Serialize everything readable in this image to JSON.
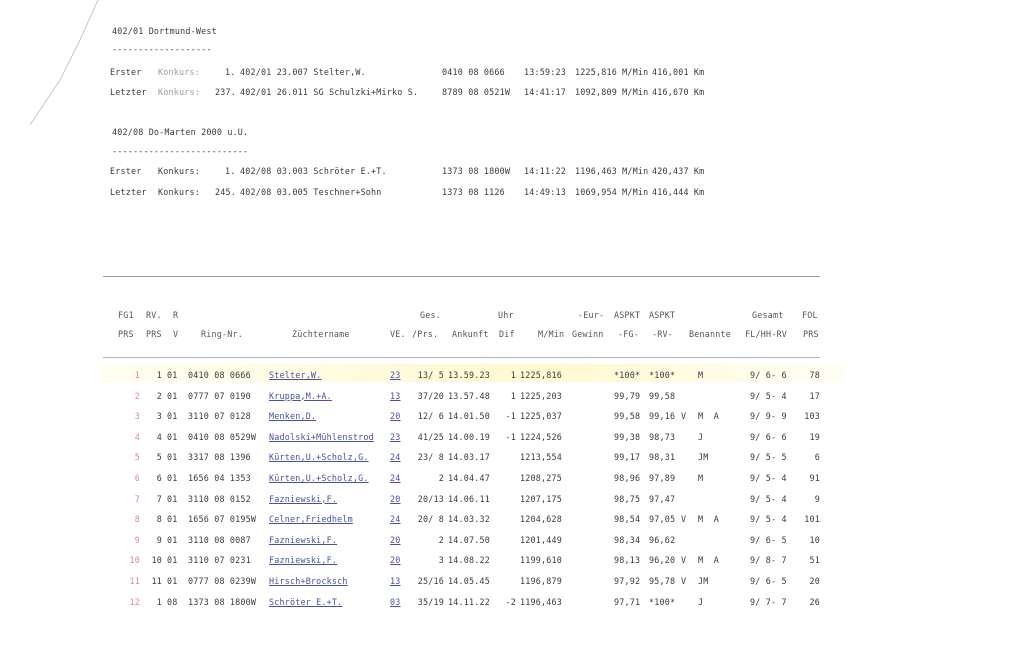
{
  "club1": {
    "title": "402/01 Dortmund-West",
    "underline": "-------------------",
    "first": {
      "label": "Erster",
      "label2": "Konkurs:",
      "rank": "1.",
      "line": "402/01 23.007 Stelter,W.",
      "ring": "0410 08 0666",
      "time": "13:59:23",
      "speed": "1225,816 M/Min",
      "km": "416,001 Km"
    },
    "last": {
      "label": "Letzter",
      "label2": "Konkurs:",
      "rank": "237.",
      "line": "402/01 26.011 SG Schulzki+Mirko S.",
      "ring": "8789 08 0521W",
      "time": "14:41:17",
      "speed": "1092,809 M/Min",
      "km": "416,670 Km"
    }
  },
  "club2": {
    "title": "402/08 Do-Marten 2000 u.U.",
    "underline": "--------------------------",
    "first": {
      "label": "Erster",
      "label2": "Konkurs:",
      "rank": "1.",
      "line": "402/08 03.003 Schröter E.+T.",
      "ring": "1373 08 1800W",
      "time": "14:11:22",
      "speed": "1196,463 M/Min",
      "km": "420,437 Km"
    },
    "last": {
      "label": "Letzter",
      "label2": "Konkurs:",
      "rank": "245.",
      "line": "402/08 03.005 Teschner+Sohn",
      "ring": "1373 08 1126",
      "time": "14:49:13",
      "speed": "1069,954 M/Min",
      "km": "416,444 Km"
    }
  },
  "header": {
    "r1": {
      "fg1": "FG1",
      "rv": "RV.",
      "r": "R",
      "ges": "Ges.",
      "uhr": "Uhr",
      "eur": "-Eur-",
      "aspkt1": "ASPKT",
      "aspkt2": "ASPKT",
      "gesamt": "Gesamt",
      "fol": "FOL"
    },
    "r2": {
      "prs1": "PRS",
      "prs2": "PRS",
      "v": "V",
      "ring": "Ring-Nr.",
      "zname": "Züchtername",
      "ve": "VE.",
      "prs": "/Prs.",
      "ankunft": "Ankunft",
      "dif": "Dif",
      "mmin": "M/Min",
      "gewinn": "Gewinn",
      "fg": "-FG-",
      "rvh": "-RV-",
      "benannte": "Benannte",
      "flhh": "FL/HH-RV",
      "prs3": "PRS"
    }
  },
  "rows": [
    {
      "n": "1",
      "rvprs": "1",
      "r": "01",
      "ring": "0410 08 0666",
      "name": "Stelter,W.",
      "ve": "23",
      "prs": "13/ 5",
      "ank": "13.59.23",
      "dif": "1",
      "mmin": "1225,816",
      "fg": "*100*",
      "rv": "*100*",
      "v": "",
      "ben": "M",
      "gesamt": "9/ 6- 6",
      "fol": "78"
    },
    {
      "n": "2",
      "rvprs": "2",
      "r": "01",
      "ring": "0777 07 0190",
      "name": "Kruppa,M.+A.",
      "ve": "13",
      "prs": "37/20",
      "ank": "13.57.48",
      "dif": "1",
      "mmin": "1225,203",
      "fg": "99,79",
      "rv": "99,58",
      "v": "",
      "ben": "",
      "gesamt": "9/ 5- 4",
      "fol": "17"
    },
    {
      "n": "3",
      "rvprs": "3",
      "r": "01",
      "ring": "3110 07 0128",
      "name": "Menken,D.",
      "ve": "20",
      "prs": "12/ 6",
      "ank": "14.01.50",
      "dif": "-1",
      "mmin": "1225,037",
      "fg": "99,58",
      "rv": "99,16",
      "v": "V",
      "ben": "M  A",
      "gesamt": "9/ 9- 9",
      "fol": "103"
    },
    {
      "n": "4",
      "rvprs": "4",
      "r": "01",
      "ring": "0410 08 0529W",
      "name": "Nadolski+Mühlenstrod",
      "ve": "23",
      "prs": "41/25",
      "ank": "14.00.19",
      "dif": "-1",
      "mmin": "1224,526",
      "fg": "99,38",
      "rv": "98,73",
      "v": "",
      "ben": "J",
      "gesamt": "9/ 6- 6",
      "fol": "19"
    },
    {
      "n": "5",
      "rvprs": "5",
      "r": "01",
      "ring": "3317 08 1396",
      "name": "Kürten,U.+Scholz,G.",
      "ve": "24",
      "prs": "23/ 8",
      "ank": "14.03.17",
      "dif": "",
      "mmin": "1213,554",
      "fg": "99,17",
      "rv": "98,31",
      "v": "",
      "ben": "JM",
      "gesamt": "9/ 5- 5",
      "fol": "6"
    },
    {
      "n": "6",
      "rvprs": "6",
      "r": "01",
      "ring": "1656 04 1353",
      "name": "Kürten,U.+Scholz,G.",
      "ve": "24",
      "prs": "2",
      "ank": "14.04.47",
      "dif": "",
      "mmin": "1208,275",
      "fg": "98,96",
      "rv": "97,89",
      "v": "",
      "ben": "M",
      "gesamt": "9/ 5- 4",
      "fol": "91"
    },
    {
      "n": "7",
      "rvprs": "7",
      "r": "01",
      "ring": "3110 08 0152",
      "name": "Fazniewski,F.",
      "ve": "20",
      "prs": "20/13",
      "ank": "14.06.11",
      "dif": "",
      "mmin": "1207,175",
      "fg": "98,75",
      "rv": "97,47",
      "v": "",
      "ben": "",
      "gesamt": "9/ 5- 4",
      "fol": "9"
    },
    {
      "n": "8",
      "rvprs": "8",
      "r": "01",
      "ring": "1656 07 0195W",
      "name": "Celner,Friedhelm",
      "ve": "24",
      "prs": "20/ 8",
      "ank": "14.03.32",
      "dif": "",
      "mmin": "1204,628",
      "fg": "98,54",
      "rv": "97,05",
      "v": "V",
      "ben": "M  A",
      "gesamt": "9/ 5- 4",
      "fol": "101"
    },
    {
      "n": "9",
      "rvprs": "9",
      "r": "01",
      "ring": "3110 08 0087",
      "name": "Fazniewski,F.",
      "ve": "20",
      "prs": "2",
      "ank": "14.07.50",
      "dif": "",
      "mmin": "1201,449",
      "fg": "98,34",
      "rv": "96,62",
      "v": "",
      "ben": "",
      "gesamt": "9/ 6- 5",
      "fol": "10"
    },
    {
      "n": "10",
      "rvprs": "10",
      "r": "01",
      "ring": "3110 07 0231",
      "name": "Fazniewski,F.",
      "ve": "20",
      "prs": "3",
      "ank": "14.08.22",
      "dif": "",
      "mmin": "1199,610",
      "fg": "98,13",
      "rv": "96,20",
      "v": "V",
      "ben": "M  A",
      "gesamt": "9/ 8- 7",
      "fol": "51"
    },
    {
      "n": "11",
      "rvprs": "11",
      "r": "01",
      "ring": "0777 08 0239W",
      "name": "Hirsch+Brocksch",
      "ve": "13",
      "prs": "25/16",
      "ank": "14.05.45",
      "dif": "",
      "mmin": "1196,879",
      "fg": "97,92",
      "rv": "95,78",
      "v": "V",
      "ben": "JM",
      "gesamt": "9/ 6- 5",
      "fol": "20"
    },
    {
      "n": "12",
      "rvprs": "1",
      "r": "08",
      "ring": "1373 08 1800W",
      "name": "Schröter E.+T.",
      "ve": "03",
      "prs": "35/19",
      "ank": "14.11.22",
      "dif": "-2",
      "mmin": "1196,463",
      "fg": "97,71",
      "rv": "*100*",
      "v": "",
      "ben": "J",
      "gesamt": "9/ 7- 7",
      "fol": "26"
    }
  ]
}
